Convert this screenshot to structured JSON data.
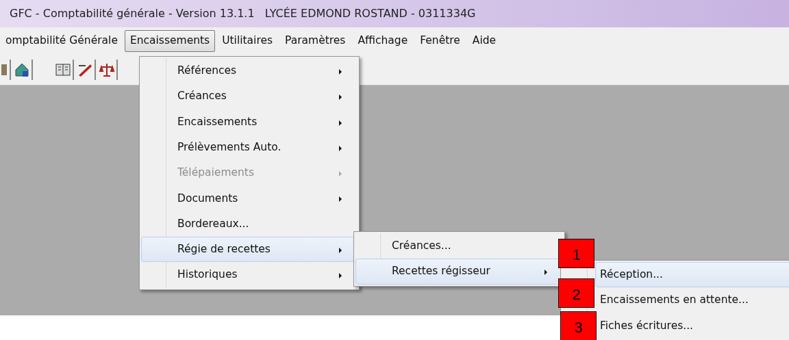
{
  "window": {
    "title": "GFC - Comptabilité générale - Version 13.1.1   LYCÉE EDMOND ROSTAND - 0311334G"
  },
  "menubar": [
    {
      "label": "omptabilité Générale",
      "selected": false
    },
    {
      "label": "Encaissements",
      "selected": true
    },
    {
      "label": "Utilitaires",
      "selected": false
    },
    {
      "label": "Paramètres",
      "selected": false
    },
    {
      "label": "Affichage",
      "selected": false
    },
    {
      "label": "Fenêtre",
      "selected": false
    },
    {
      "label": "Aide",
      "selected": false
    }
  ],
  "menu": [
    {
      "label": "Références",
      "submenu": true,
      "disabled": false,
      "selected": false
    },
    {
      "label": "Créances",
      "submenu": true,
      "disabled": false,
      "selected": false
    },
    {
      "label": "Encaissements",
      "submenu": true,
      "disabled": false,
      "selected": false
    },
    {
      "label": "Prélèvements Auto.",
      "submenu": true,
      "disabled": false,
      "selected": false
    },
    {
      "label": "Télépaiements",
      "submenu": true,
      "disabled": true,
      "selected": false
    },
    {
      "label": "Documents",
      "submenu": true,
      "disabled": false,
      "selected": false
    },
    {
      "label": "Bordereaux...",
      "submenu": false,
      "disabled": false,
      "selected": false
    },
    {
      "label": "Régie de recettes",
      "submenu": true,
      "disabled": false,
      "selected": true
    },
    {
      "label": "Historiques",
      "submenu": true,
      "disabled": false,
      "selected": false
    }
  ],
  "submenu": [
    {
      "label": "Créances...",
      "submenu": false,
      "selected": false
    },
    {
      "label": "Recettes régisseur",
      "submenu": true,
      "selected": true
    }
  ],
  "submenu_2": [
    {
      "label": "Réception...",
      "selected": true
    },
    {
      "label": "Encaissements en attente...",
      "selected": false
    },
    {
      "label": "Fiches écritures...",
      "selected": false
    }
  ],
  "callouts": [
    "1",
    "2",
    "3"
  ]
}
